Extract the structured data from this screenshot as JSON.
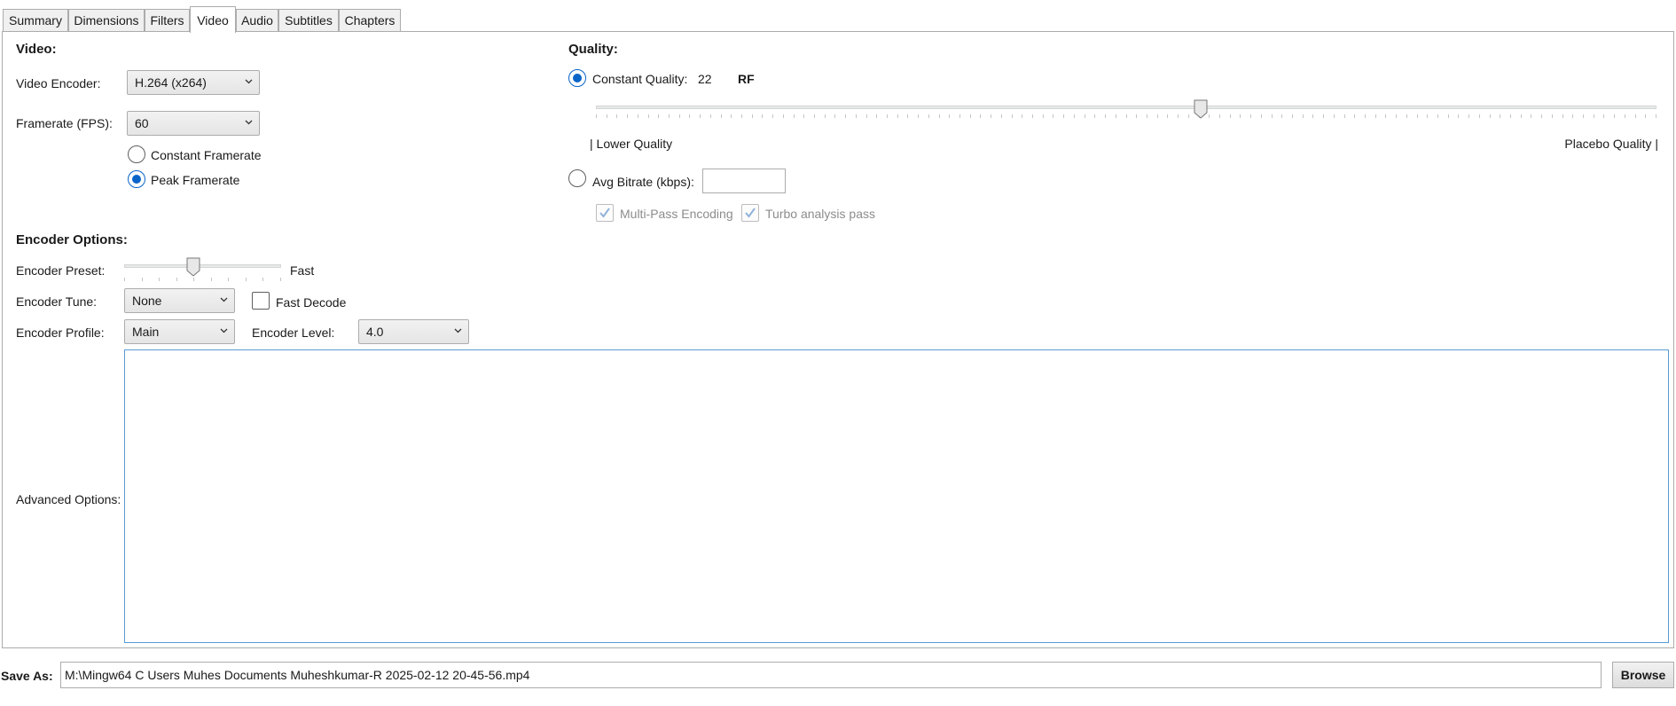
{
  "tabs": [
    {
      "label": "Summary"
    },
    {
      "label": "Dimensions"
    },
    {
      "label": "Filters"
    },
    {
      "label": "Video"
    },
    {
      "label": "Audio"
    },
    {
      "label": "Subtitles"
    },
    {
      "label": "Chapters"
    }
  ],
  "video": {
    "section_title": "Video:",
    "encoder_label": "Video Encoder:",
    "encoder_value": "H.264 (x264)",
    "framerate_label": "Framerate (FPS):",
    "framerate_value": "60",
    "constant_framerate_label": "Constant Framerate",
    "constant_framerate_checked": false,
    "peak_framerate_label": "Peak Framerate",
    "peak_framerate_checked": true
  },
  "quality": {
    "section_title": "Quality:",
    "constant_quality_label": "Constant Quality:",
    "constant_quality_checked": true,
    "quality_value": "22",
    "quality_unit": "RF",
    "slider_fraction": 0.57,
    "lower_label": "| Lower Quality",
    "upper_label": "Placebo Quality |",
    "avg_bitrate_label": "Avg Bitrate (kbps):",
    "avg_bitrate_checked": false,
    "avg_bitrate_value": "",
    "multipass_label": "Multi-Pass Encoding",
    "multipass_checked": true,
    "turbo_label": "Turbo analysis pass",
    "turbo_checked": true
  },
  "encoder_options": {
    "section_title": "Encoder Options:",
    "preset_label": "Encoder Preset:",
    "preset_value": "Fast",
    "preset_fraction": 0.44,
    "tune_label": "Encoder Tune:",
    "tune_value": "None",
    "fast_decode_label": "Fast Decode",
    "fast_decode_checked": false,
    "profile_label": "Encoder Profile:",
    "profile_value": "Main",
    "level_label": "Encoder Level:",
    "level_value": "4.0",
    "advanced_label": "Advanced Options:",
    "advanced_value": ""
  },
  "save": {
    "label": "Save As:",
    "path": "M:\\Mingw64  C Users Muhes Documents Muheshkumar-R 2025-02-12 20-45-56.mp4",
    "browse_label": "Browse"
  },
  "colors": {
    "accent": "#0a64c8",
    "border": "#acacac"
  }
}
